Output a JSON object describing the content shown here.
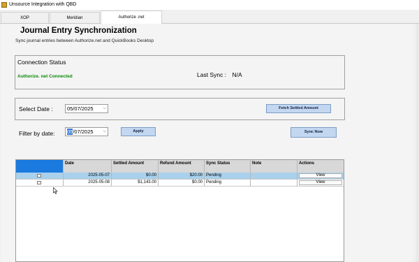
{
  "window": {
    "title": "Unsource Integration with QBD"
  },
  "tabs": [
    {
      "label": "XOP",
      "active": false
    },
    {
      "label": "Meridian",
      "active": false
    },
    {
      "label": "Authorize .net",
      "active": true
    }
  ],
  "page": {
    "title": "Journal Entry Synchronization",
    "subtitle": "Sync journal entries between Authorize.net and QuickBooks Desktop"
  },
  "connection": {
    "title": "Connection Status",
    "state": "Authorize. net Connected",
    "state_color": "#0a8a0a",
    "last_sync_label": "Last Sync :",
    "last_sync_value": "N/A"
  },
  "select_date": {
    "label": "Select Date :",
    "value": "05/07/2025",
    "fetch_button": "Fetch Settled Amount"
  },
  "filter": {
    "label": "Filter by date:",
    "value_selected": "05",
    "value_rest": "/07/2025",
    "apply_button": "Apply",
    "sync_button": "Sync Now"
  },
  "grid": {
    "columns": [
      "",
      "Date",
      "Settled Amount",
      "Refund Amount",
      "Sync Status",
      "Note",
      "Actions"
    ],
    "rows": [
      {
        "date": "2025-05-07",
        "settled": "$0.00",
        "refund": "$20.00",
        "status": "Pending",
        "note": "",
        "action": "View",
        "selected": true
      },
      {
        "date": "2025-05-08",
        "settled": "$1,143.00",
        "refund": "$0.00",
        "status": "Pending",
        "note": "",
        "action": "View",
        "selected": false
      }
    ]
  },
  "colors": {
    "accent": "#1a7ae0",
    "button_bg": "#c3d7f0",
    "selected_row": "#a9d1ec"
  }
}
